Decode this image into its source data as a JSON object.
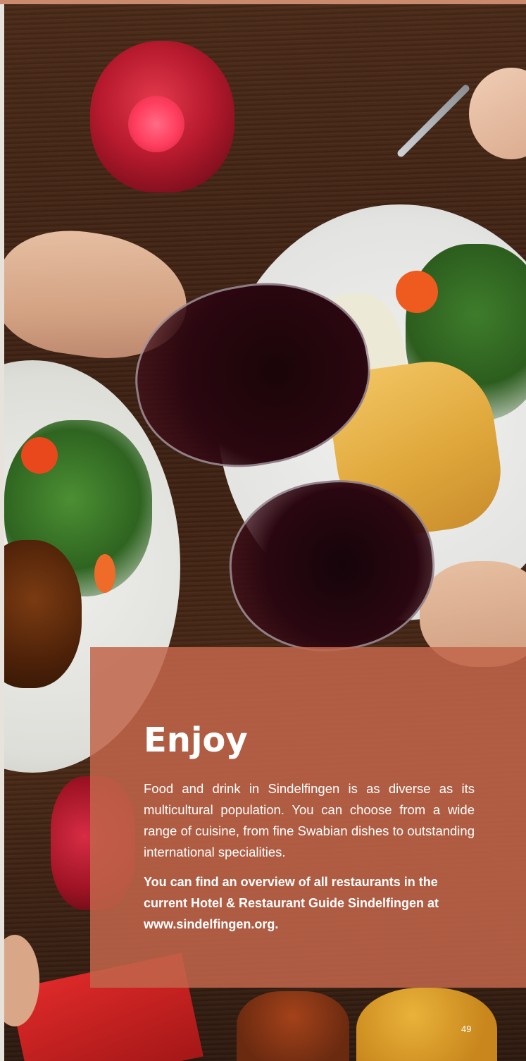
{
  "panel": {
    "heading": "Enjoy",
    "paragraph": "Food and drink in Sindelfingen is as diverse as its multicultural population. You can choose from a wide range of cuisine, from fine Swabian dishes to outstanding international specialities.",
    "highlight": "You can find an overview of all restaurants in the current Hotel & Restaurant Guide Sindelfingen at www.sindelfingen.org."
  },
  "page_number": "49",
  "colors": {
    "panel": "#c1654a",
    "top_bar": "#c98a6e",
    "text": "#ffffff"
  },
  "photo": {
    "subject": "dinner-toast-photo"
  }
}
